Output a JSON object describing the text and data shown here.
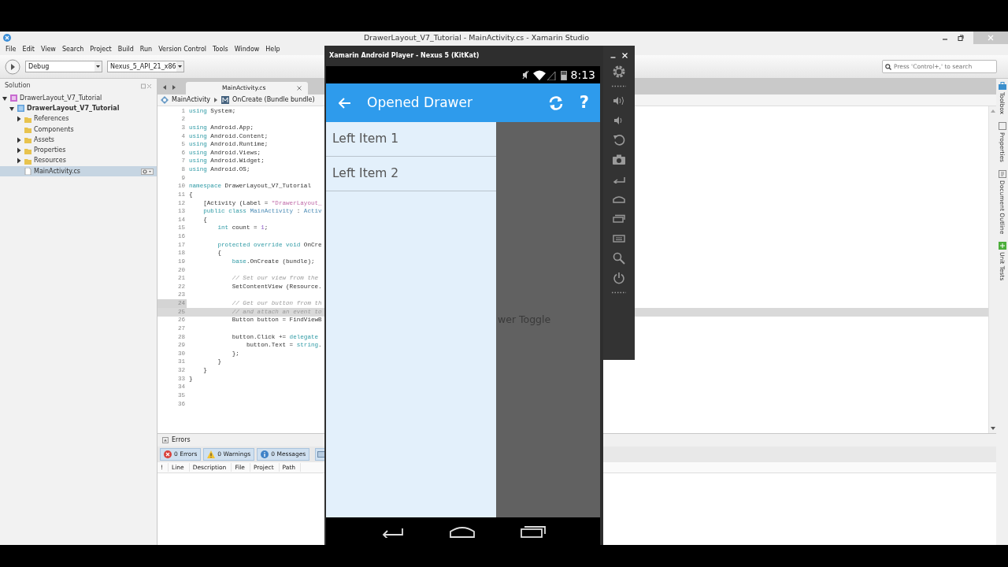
{
  "ide": {
    "title": "DrawerLayout_V7_Tutorial - MainActivity.cs - Xamarin Studio",
    "menu": [
      "File",
      "Edit",
      "View",
      "Search",
      "Project",
      "Build",
      "Run",
      "Version Control",
      "Tools",
      "Window",
      "Help"
    ],
    "toolbar": {
      "configuration": "Debug",
      "device": "Nexus_5_API_21_x86",
      "search": {
        "placeholder": "Press 'Control+,' to search"
      }
    },
    "solution": {
      "title": "Solution",
      "tree": [
        {
          "label": "DrawerLayout_V7_Tutorial",
          "kind": "solution",
          "expanded": true,
          "selected": false,
          "children": [
            {
              "label": "DrawerLayout_V7_Tutorial",
              "kind": "project",
              "expanded": true,
              "selected": false,
              "children": [
                {
                  "label": "References",
                  "kind": "folder",
                  "expanded": false,
                  "selected": false
                },
                {
                  "label": "Components",
                  "kind": "folder",
                  "selected": false
                },
                {
                  "label": "Assets",
                  "kind": "folder",
                  "expanded": false,
                  "selected": false
                },
                {
                  "label": "Properties",
                  "kind": "folder",
                  "expanded": false,
                  "selected": false
                },
                {
                  "label": "Resources",
                  "kind": "folder",
                  "expanded": false,
                  "selected": false
                },
                {
                  "label": "MainActivity.cs",
                  "kind": "file",
                  "selected": true
                }
              ]
            }
          ]
        }
      ]
    },
    "editor": {
      "tab": {
        "label": "MainActivity.cs"
      },
      "breadcrumb": [
        "MainActivity",
        "OnCreate (Bundle bundle)"
      ],
      "lines": [
        {
          "number": "1",
          "current": false,
          "selected": false,
          "tokens": [
            {
              "kind": "keyword",
              "text": "using"
            },
            {
              "kind": "plain",
              "text": " System;"
            }
          ]
        },
        {
          "number": "2",
          "current": false,
          "selected": false
        },
        {
          "number": "3",
          "current": false,
          "selected": false,
          "tokens": [
            {
              "kind": "keyword",
              "text": "using"
            },
            {
              "kind": "plain",
              "text": " Android.App;"
            }
          ]
        },
        {
          "number": "4",
          "current": false,
          "selected": false,
          "tokens": [
            {
              "kind": "keyword",
              "text": "using"
            },
            {
              "kind": "plain",
              "text": " Android.Content;"
            }
          ]
        },
        {
          "number": "5",
          "current": false,
          "selected": false,
          "tokens": [
            {
              "kind": "keyword",
              "text": "using"
            },
            {
              "kind": "plain",
              "text": " Android.Runtime;"
            }
          ]
        },
        {
          "number": "6",
          "current": false,
          "selected": false,
          "tokens": [
            {
              "kind": "keyword",
              "text": "using"
            },
            {
              "kind": "plain",
              "text": " Android.Views;"
            }
          ]
        },
        {
          "number": "7",
          "current": false,
          "selected": false,
          "tokens": [
            {
              "kind": "keyword",
              "text": "using"
            },
            {
              "kind": "plain",
              "text": " Android.Widget;"
            }
          ]
        },
        {
          "number": "8",
          "current": false,
          "selected": false,
          "tokens": [
            {
              "kind": "keyword",
              "text": "using"
            },
            {
              "kind": "plain",
              "text": " Android.OS;"
            }
          ]
        },
        {
          "number": "9",
          "current": false,
          "selected": false
        },
        {
          "number": "10",
          "current": false,
          "selected": false,
          "tokens": [
            {
              "kind": "keyword",
              "text": "namespace"
            },
            {
              "kind": "plain",
              "text": " DrawerLayout_V7_Tutorial"
            }
          ]
        },
        {
          "number": "11",
          "current": false,
          "selected": false,
          "tokens": [
            {
              "kind": "plain",
              "text": "{"
            }
          ]
        },
        {
          "number": "12",
          "current": false,
          "selected": false,
          "tokens": [
            {
              "kind": "plain",
              "text": "    [Activity (Label = "
            },
            {
              "kind": "string",
              "text": "\"DrawerLayout_"
            }
          ]
        },
        {
          "number": "13",
          "current": false,
          "selected": false,
          "tokens": [
            {
              "kind": "keyword",
              "text": "    public class"
            },
            {
              "kind": "type",
              "text": " MainActivity"
            },
            {
              "kind": "plain",
              "text": " :"
            },
            {
              "kind": "type",
              "text": " Activ"
            }
          ]
        },
        {
          "number": "14",
          "current": false,
          "selected": false,
          "tokens": [
            {
              "kind": "plain",
              "text": "    {"
            }
          ]
        },
        {
          "number": "15",
          "current": false,
          "selected": false,
          "tokens": [
            {
              "kind": "keyword",
              "text": "        int"
            },
            {
              "kind": "plain",
              "text": " count ="
            },
            {
              "kind": "number",
              "text": " 1"
            },
            {
              "kind": "plain",
              "text": ";"
            }
          ]
        },
        {
          "number": "16",
          "current": false,
          "selected": false
        },
        {
          "number": "17",
          "current": false,
          "selected": false,
          "tokens": [
            {
              "kind": "keyword",
              "text": "        protected override void"
            },
            {
              "kind": "plain",
              "text": " OnCre"
            }
          ]
        },
        {
          "number": "18",
          "current": false,
          "selected": false,
          "tokens": [
            {
              "kind": "plain",
              "text": "        {"
            }
          ]
        },
        {
          "number": "19",
          "current": false,
          "selected": false,
          "tokens": [
            {
              "kind": "keyword",
              "text": "            base"
            },
            {
              "kind": "plain",
              "text": ".OnCreate (bundle);"
            }
          ]
        },
        {
          "number": "20",
          "current": false,
          "selected": false
        },
        {
          "number": "21",
          "current": false,
          "selected": false,
          "tokens": [
            {
              "kind": "comment",
              "text": "            // Set our view from the"
            }
          ]
        },
        {
          "number": "22",
          "current": false,
          "selected": false,
          "tokens": [
            {
              "kind": "plain",
              "text": "            SetContentView (Resource."
            }
          ]
        },
        {
          "number": "23",
          "current": false,
          "selected": false
        },
        {
          "number": "24",
          "current": true,
          "selected": false,
          "tokens": [
            {
              "kind": "comment",
              "text": "            // Get our button from th"
            }
          ]
        },
        {
          "number": "25",
          "current": false,
          "selected": true,
          "tokens": [
            {
              "kind": "comment",
              "text": "            // and attach an event to"
            }
          ]
        },
        {
          "number": "26",
          "current": false,
          "selected": false,
          "tokens": [
            {
              "kind": "plain",
              "text": "            Button button = FindViewB"
            }
          ]
        },
        {
          "number": "27",
          "current": false,
          "selected": false
        },
        {
          "number": "28",
          "current": false,
          "selected": false,
          "tokens": [
            {
              "kind": "plain",
              "text": "            button.Click +="
            },
            {
              "kind": "keyword",
              "text": " delegate"
            }
          ]
        },
        {
          "number": "29",
          "current": false,
          "selected": false,
          "tokens": [
            {
              "kind": "plain",
              "text": "                button.Text ="
            },
            {
              "kind": "keyword",
              "text": " string"
            },
            {
              "kind": "plain",
              "text": "."
            }
          ]
        },
        {
          "number": "30",
          "current": false,
          "selected": false,
          "tokens": [
            {
              "kind": "plain",
              "text": "            };"
            }
          ]
        },
        {
          "number": "31",
          "current": false,
          "selected": false,
          "tokens": [
            {
              "kind": "plain",
              "text": "        }"
            }
          ]
        },
        {
          "number": "32",
          "current": false,
          "selected": false,
          "tokens": [
            {
              "kind": "plain",
              "text": "    }"
            }
          ]
        },
        {
          "number": "33",
          "current": false,
          "selected": false,
          "tokens": [
            {
              "kind": "plain",
              "text": "}"
            }
          ]
        },
        {
          "number": "34",
          "current": false,
          "selected": false
        },
        {
          "number": "35",
          "current": false,
          "selected": false
        },
        {
          "number": "36",
          "current": false,
          "selected": false
        }
      ]
    },
    "errors_pane": {
      "title": "Errors",
      "filters": [
        {
          "label": "0 Errors",
          "kind": "error"
        },
        {
          "label": "0 Warnings",
          "kind": "warning"
        },
        {
          "label": "0 Messages",
          "kind": "info"
        }
      ],
      "columns": [
        "!",
        "Line",
        "Description",
        "File",
        "Project",
        "Path"
      ]
    },
    "side_pads": [
      {
        "label": "Toolbox",
        "kind": "toolbox"
      },
      {
        "label": "Properties",
        "kind": "properties"
      },
      {
        "label": "Document Outline",
        "kind": "outline"
      },
      {
        "label": "Unit Tests",
        "kind": "tests"
      }
    ]
  },
  "emulator": {
    "title": "Xamarin Android Player - Nexus 5 (KitKat)",
    "time": "8:13",
    "app_title": "Opened Drawer",
    "help_glyph": "?",
    "drawer_items": [
      "Left Item 1",
      "Left Item 2"
    ],
    "content_text": "wer Toggle",
    "side_tools": [
      {
        "kind": "settings"
      },
      {
        "kind": "dots"
      },
      {
        "kind": "volume-up"
      },
      {
        "kind": "volume-down"
      },
      {
        "kind": "rotate"
      },
      {
        "kind": "camera"
      },
      {
        "kind": "back"
      },
      {
        "kind": "home"
      },
      {
        "kind": "recents"
      },
      {
        "kind": "menu"
      },
      {
        "kind": "search"
      },
      {
        "kind": "power"
      },
      {
        "kind": "dots"
      }
    ]
  }
}
